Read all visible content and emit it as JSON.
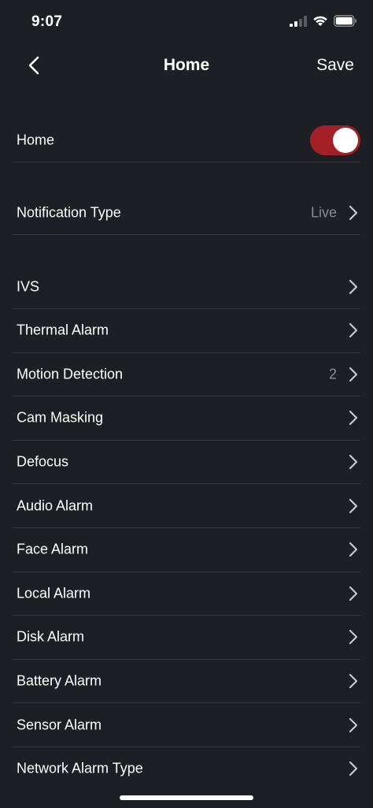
{
  "status_bar": {
    "time": "9:07",
    "icons": [
      "cellular-signal-icon",
      "wifi-icon",
      "battery-icon"
    ]
  },
  "nav": {
    "back_icon": "chevron-left-icon",
    "title": "Home",
    "save_label": "Save"
  },
  "home_toggle": {
    "label": "Home",
    "enabled": true,
    "accent_color": "#a32026"
  },
  "notification_type": {
    "label": "Notification Type",
    "value": "Live"
  },
  "alarm_items": [
    {
      "label": "IVS",
      "value": ""
    },
    {
      "label": "Thermal Alarm",
      "value": ""
    },
    {
      "label": "Motion Detection",
      "value": "2"
    },
    {
      "label": "Cam Masking",
      "value": ""
    },
    {
      "label": "Defocus",
      "value": ""
    },
    {
      "label": "Audio Alarm",
      "value": ""
    },
    {
      "label": "Face Alarm",
      "value": ""
    },
    {
      "label": "Local Alarm",
      "value": ""
    },
    {
      "label": "Disk Alarm",
      "value": ""
    },
    {
      "label": "Battery Alarm",
      "value": ""
    },
    {
      "label": "Sensor Alarm",
      "value": ""
    },
    {
      "label": "Network Alarm Type",
      "value": ""
    }
  ]
}
